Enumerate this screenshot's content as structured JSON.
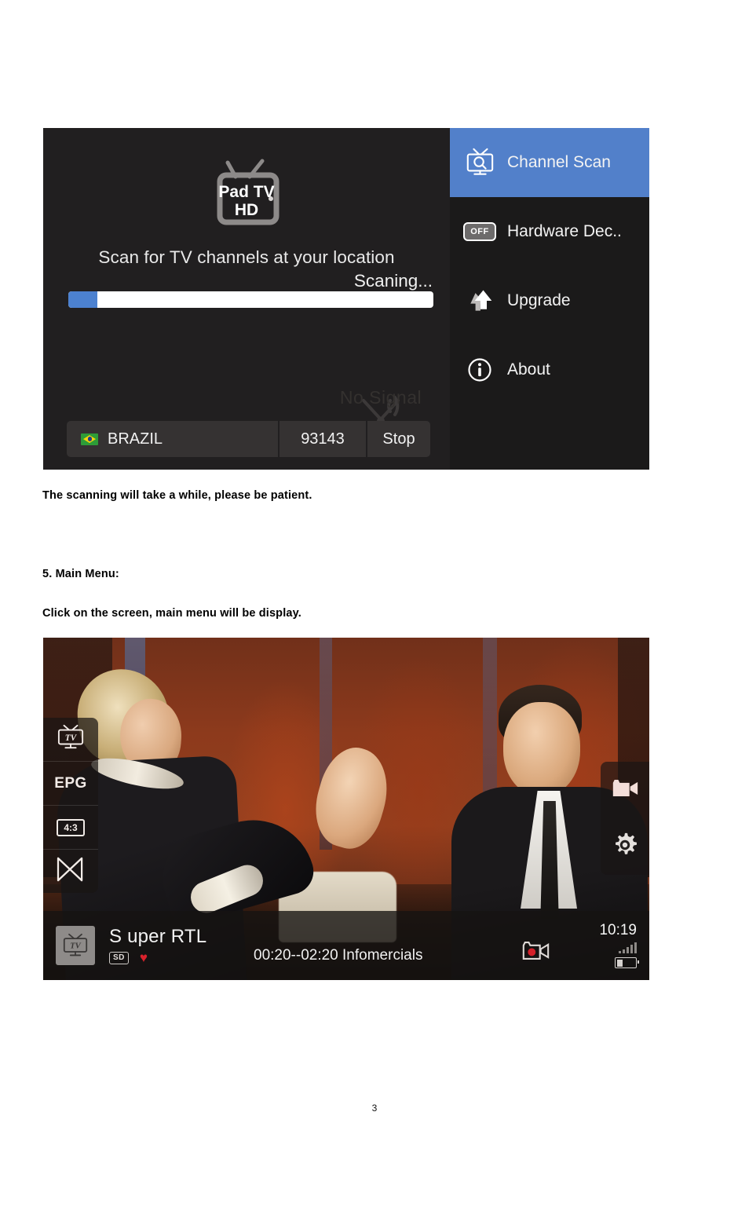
{
  "document": {
    "page_number": "3",
    "paragraphs": {
      "patience_note": "The scanning will take a while, please be patient.",
      "section_heading": "5. Main Menu:",
      "section_body": "Click on the screen, main menu will be display."
    }
  },
  "colors": {
    "menu_highlight": "#5280ca",
    "progress_fill": "#4c81d0",
    "progress_track": "#ffffff",
    "app_background": "#211f20",
    "menu_background": "#1b1a1a",
    "favorite_heart": "#d9222c",
    "record_dot": "#d4202a"
  },
  "scan_screen": {
    "logo": {
      "icon": "pad-tv-hd-logo-icon",
      "line1": "Pad TV",
      "line2": "HD"
    },
    "watermark": {
      "text": "No Signal",
      "icon": "no-signal-antenna-icon"
    },
    "title": "Scan for TV channels at your location",
    "status": "Scaning...",
    "progress": {
      "percent": 8
    },
    "bottom_bar": {
      "country_flag_icon": "brazil-flag-icon",
      "country": "BRAZIL",
      "frequency": "93143",
      "stop_label": "Stop"
    },
    "menu": {
      "items": [
        {
          "label": "Channel Scan",
          "icon": "tv-search-icon",
          "active": true
        },
        {
          "label": "Hardware Dec..",
          "icon": "toggle-off-icon",
          "active": false,
          "toggle_label": "OFF"
        },
        {
          "label": "Upgrade",
          "icon": "upgrade-arrow-icon",
          "active": false
        },
        {
          "label": "About",
          "icon": "info-circle-icon",
          "active": false
        }
      ]
    }
  },
  "player_screen": {
    "left_menu": [
      {
        "name": "channel-list",
        "icon": "tv-icon",
        "label": "TV"
      },
      {
        "name": "epg",
        "icon": "epg-icon",
        "label": "EPG"
      },
      {
        "name": "aspect-ratio",
        "icon": "aspect-ratio-icon",
        "label": "4:3"
      },
      {
        "name": "audio-track",
        "icon": "speaker-icon",
        "label": ""
      }
    ],
    "right_menu": [
      {
        "name": "record",
        "icon": "video-camera-icon"
      },
      {
        "name": "settings",
        "icon": "gear-icon"
      }
    ],
    "info_bar": {
      "channel_logo_icon": "tv-channel-logo-icon",
      "channel_name": "S uper  RTL",
      "quality_badge": "SD",
      "favorite_icon": "heart-icon",
      "program": "00:20--02:20 Infomercials",
      "record_icon": "record-camera-icon",
      "clock": "10:19",
      "signal_icon": "signal-bars-icon",
      "battery_icon": "battery-low-icon"
    }
  }
}
